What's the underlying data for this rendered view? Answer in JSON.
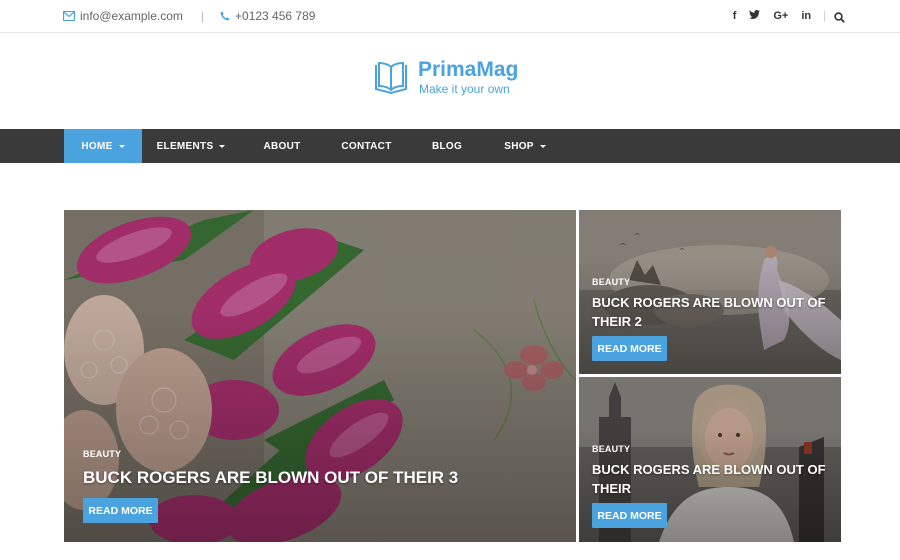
{
  "topbar": {
    "email": "info@example.com",
    "phone": "+0123 456 789",
    "social": [
      "f",
      "t",
      "G+",
      "in"
    ]
  },
  "brand": {
    "name": "PrimaMag",
    "tagline": "Make it your own"
  },
  "nav": {
    "items": [
      {
        "label": "HOME",
        "caret": true
      },
      {
        "label": "ELEMENTS",
        "caret": true
      },
      {
        "label": "ABOUT",
        "caret": false
      },
      {
        "label": "CONTACT",
        "caret": false
      },
      {
        "label": "BLOG",
        "caret": false
      },
      {
        "label": "SHOP",
        "caret": true
      }
    ]
  },
  "featured": [
    {
      "category": "BEAUTY",
      "title": "BUCK ROGERS ARE BLOWN OUT OF THEIR 3",
      "button": "READ MORE"
    },
    {
      "category": "BEAUTY",
      "title": "BUCK ROGERS ARE BLOWN OUT OF THEIR 2",
      "button": "READ MORE"
    },
    {
      "category": "BEAUTY",
      "title": "BUCK ROGERS ARE BLOWN OUT OF THEIR",
      "button": "READ MORE"
    }
  ],
  "colors": {
    "accent": "#4aa3df",
    "nav_bg": "#3a3a3a"
  }
}
